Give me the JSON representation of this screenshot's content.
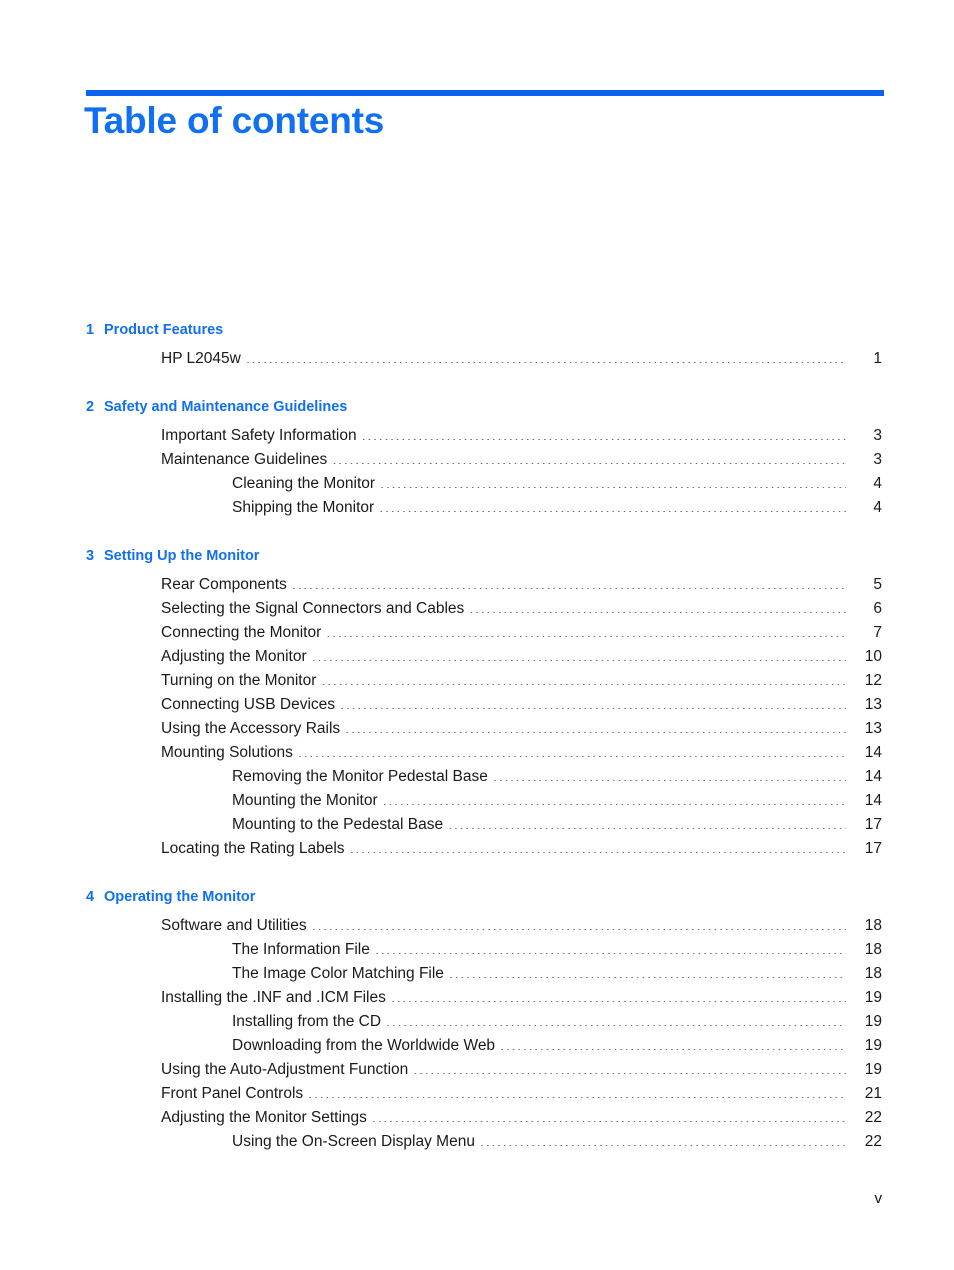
{
  "page": {
    "title": "Table of contents",
    "accent_color": "#1070f0",
    "rule_color": "#0a62ef",
    "footer_page_label": "v"
  },
  "toc": {
    "chapters": [
      {
        "number": "1",
        "title": "Product Features",
        "entries": [
          {
            "level": 1,
            "label": "HP L2045w",
            "page": "1"
          }
        ]
      },
      {
        "number": "2",
        "title": "Safety and Maintenance Guidelines",
        "entries": [
          {
            "level": 1,
            "label": "Important Safety Information",
            "page": "3"
          },
          {
            "level": 1,
            "label": "Maintenance Guidelines",
            "page": "3"
          },
          {
            "level": 2,
            "label": "Cleaning the Monitor",
            "page": "4"
          },
          {
            "level": 2,
            "label": "Shipping the Monitor",
            "page": "4"
          }
        ]
      },
      {
        "number": "3",
        "title": "Setting Up the Monitor",
        "entries": [
          {
            "level": 1,
            "label": "Rear Components",
            "page": "5"
          },
          {
            "level": 1,
            "label": "Selecting the Signal Connectors and Cables",
            "page": "6"
          },
          {
            "level": 1,
            "label": "Connecting the Monitor",
            "page": "7"
          },
          {
            "level": 1,
            "label": "Adjusting the Monitor",
            "page": "10"
          },
          {
            "level": 1,
            "label": "Turning on the Monitor",
            "page": "12"
          },
          {
            "level": 1,
            "label": "Connecting USB Devices",
            "page": "13"
          },
          {
            "level": 1,
            "label": "Using the Accessory Rails",
            "page": "13"
          },
          {
            "level": 1,
            "label": "Mounting Solutions",
            "page": "14"
          },
          {
            "level": 2,
            "label": "Removing the Monitor Pedestal Base",
            "page": "14"
          },
          {
            "level": 2,
            "label": "Mounting the Monitor",
            "page": "14"
          },
          {
            "level": 2,
            "label": "Mounting to the Pedestal Base",
            "page": "17"
          },
          {
            "level": 1,
            "label": "Locating the Rating Labels",
            "page": "17"
          }
        ]
      },
      {
        "number": "4",
        "title": "Operating the Monitor",
        "entries": [
          {
            "level": 1,
            "label": "Software and Utilities",
            "page": "18"
          },
          {
            "level": 2,
            "label": "The Information File",
            "page": "18"
          },
          {
            "level": 2,
            "label": "The Image Color Matching File",
            "page": "18"
          },
          {
            "level": 1,
            "label": "Installing the .INF and .ICM Files",
            "page": "19"
          },
          {
            "level": 2,
            "label": "Installing from the CD",
            "page": "19"
          },
          {
            "level": 2,
            "label": "Downloading from the Worldwide Web",
            "page": "19"
          },
          {
            "level": 1,
            "label": "Using the Auto-Adjustment Function",
            "page": "19"
          },
          {
            "level": 1,
            "label": "Front Panel Controls",
            "page": "21"
          },
          {
            "level": 1,
            "label": "Adjusting the Monitor Settings",
            "page": "22"
          },
          {
            "level": 2,
            "label": "Using the On-Screen Display Menu",
            "page": "22"
          }
        ]
      }
    ]
  }
}
